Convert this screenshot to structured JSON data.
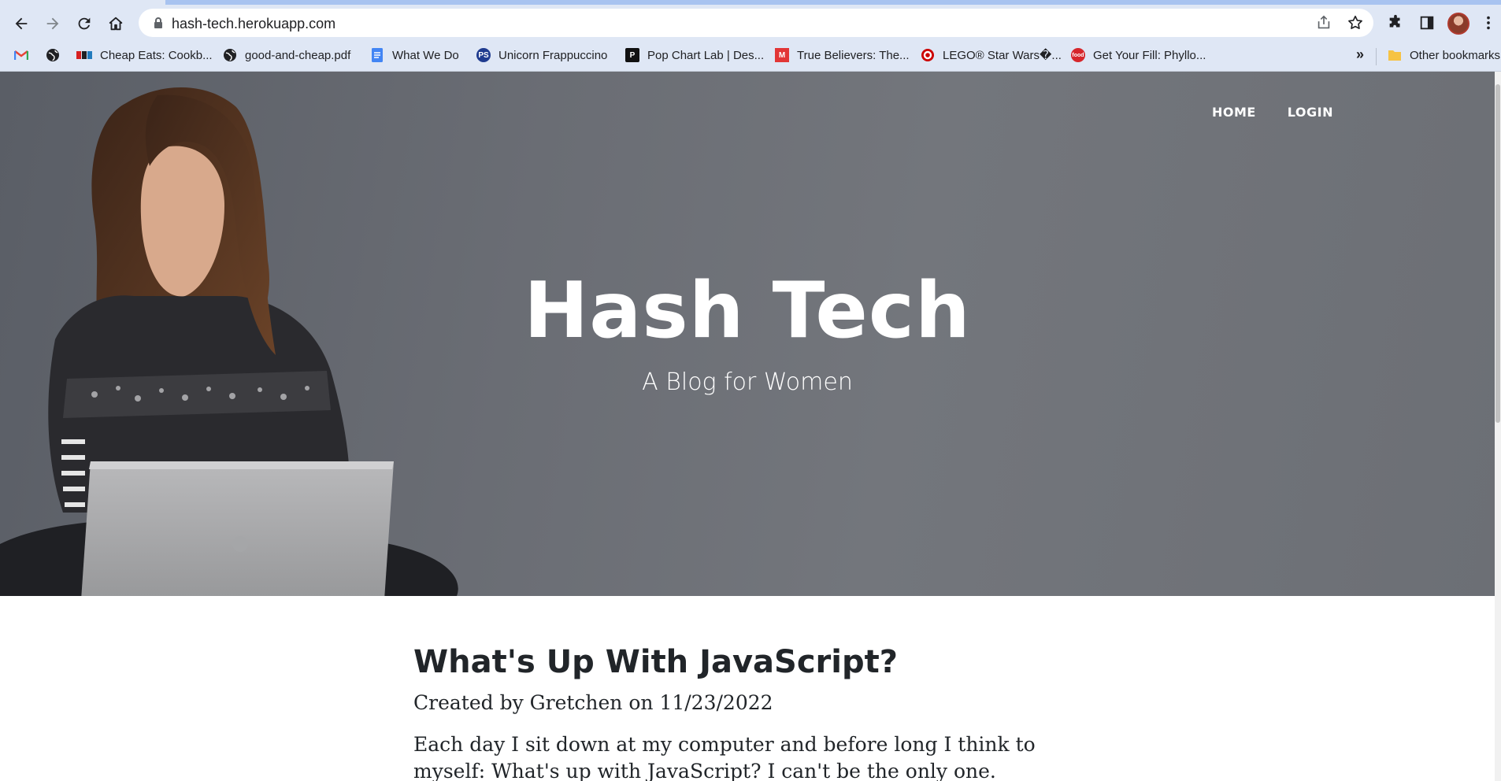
{
  "browser": {
    "url": "hash-tech.herokuapp.com",
    "bookmarks": [
      {
        "label": "",
        "icon": "gmail-icon"
      },
      {
        "label": "",
        "icon": "globe-icon"
      },
      {
        "label": "Cheap Eats: Cookb...",
        "icon": "npr-icon"
      },
      {
        "label": "good-and-cheap.pdf",
        "icon": "globe-icon"
      },
      {
        "label": "What We Do",
        "icon": "docs-icon"
      },
      {
        "label": "Unicorn Frappuccino",
        "icon": "ps-icon"
      },
      {
        "label": "Pop Chart Lab | Des...",
        "icon": "p-icon"
      },
      {
        "label": "True Believers: The...",
        "icon": "marvel-icon"
      },
      {
        "label": "LEGO® Star Wars�...",
        "icon": "target-icon"
      },
      {
        "label": "Get Your Fill: Phyllo...",
        "icon": "food-icon"
      }
    ],
    "more_bookmarks": "»",
    "other_bookmarks": "Other bookmarks"
  },
  "nav": {
    "home": "HOME",
    "login": "LOGIN"
  },
  "hero": {
    "title": "Hash Tech",
    "subtitle": "A Blog for Women"
  },
  "post": {
    "title": "What's Up With JavaScript?",
    "meta": "Created by Gretchen on 11/23/2022",
    "body": "Each day I sit down at my computer and before long I think to myself: What's up with JavaScript? I can't be the only one. Sound off in the"
  }
}
